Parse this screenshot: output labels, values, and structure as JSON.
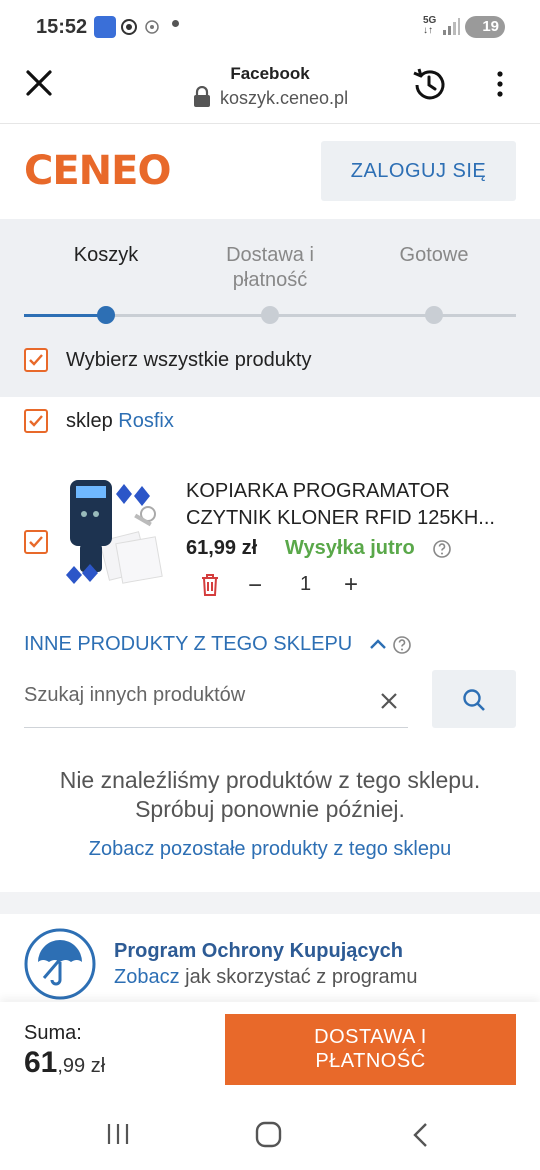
{
  "status_bar": {
    "time": "15:52",
    "net_top": "5G",
    "net_bottom": "↓↑",
    "battery": "19",
    "icons": [
      "app-icon",
      "circle-icon",
      "eye-icon",
      "dot-icon",
      "signal-icon",
      "battery-icon"
    ]
  },
  "browser": {
    "title": "Facebook",
    "url": "koszyk.ceneo.pl",
    "icons": [
      "close-icon",
      "lock-icon",
      "history-icon",
      "more-vert-icon"
    ]
  },
  "header": {
    "logo": "CENEO",
    "login_label": "ZALOGUJ SIĘ",
    "colors": {
      "brand": "#e8692a",
      "accent": "#2d6fb4"
    }
  },
  "steps": {
    "items": [
      {
        "label": "Koszyk"
      },
      {
        "label": "Dostawa i płatność"
      },
      {
        "label": "Gotowe"
      }
    ],
    "current_index": 0
  },
  "cart": {
    "select_all_label": "Wybierz wszystkie produkty",
    "shop_prefix": "sklep",
    "shop_name": "Rosfix",
    "product": {
      "title_line1": "KOPIARKA PROGRAMATOR",
      "title_line2": "CZYTNIK KLONER RFID 125KH...",
      "price": "61,99 zł",
      "shipping": "Wysyłka jutro",
      "quantity": "1",
      "qty_minus": "−",
      "qty_plus": "+"
    }
  },
  "other_products": {
    "heading": "INNE PRODUKTY Z TEGO SKLEPU",
    "search_placeholder": "Szukaj innych produktów",
    "empty_line1": "Nie znaleźliśmy produktów z tego sklepu.",
    "empty_line2": "Spróbuj ponownie później.",
    "see_more": "Zobacz pozostałe produkty z tego sklepu"
  },
  "protection": {
    "title": "Program Ochrony Kupujących",
    "link": "Zobacz",
    "rest": "jak skorzystać z programu"
  },
  "summary": {
    "sum_label": "Suma:",
    "sum_big": "61",
    "sum_small": ",99 zł",
    "next_line1": "DOSTAWA I",
    "next_line2": "PŁATNOŚĆ"
  },
  "nav": {
    "icons": [
      "recents-icon",
      "home-icon",
      "back-icon"
    ]
  }
}
